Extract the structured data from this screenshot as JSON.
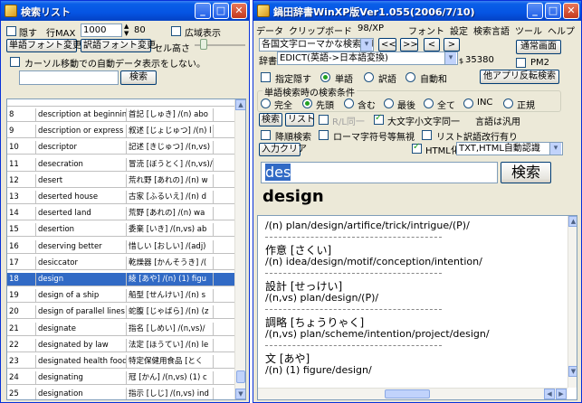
{
  "left": {
    "title": "検索リスト",
    "hide_label": "隠す",
    "row_max_label": "行MAX",
    "row_max_value": "1000",
    "spin_value": "80",
    "wide_display_label": "広域表示",
    "headword_font_btn": "単語フォント変更",
    "translation_font_btn": "訳語フォント変更",
    "cell_height_label": "セル高さ",
    "cursor_autodisplay_label": "カーソル移動での自動データ表示をしない。",
    "search_btn": "検索",
    "rows": [
      {
        "n": "8",
        "en": "description at beginnin",
        "ja": "首記 [しゅき] /(n) abo"
      },
      {
        "n": "9",
        "en": "description or express",
        "ja": "叙述 [じょじゅつ] /(n) l"
      },
      {
        "n": "10",
        "en": "descriptor",
        "ja": "記述 [きじゅつ] /(n,vs)"
      },
      {
        "n": "11",
        "en": "desecration",
        "ja": "冒涜 [ぼうとく] /(n,vs)/"
      },
      {
        "n": "12",
        "en": "desert",
        "ja": "荒れ野 [あれの] /(n) w"
      },
      {
        "n": "13",
        "en": "deserted house",
        "ja": "古家 [ふるいえ] /(n) d"
      },
      {
        "n": "14",
        "en": "deserted land",
        "ja": "荒野 [あれの] /(n) wa"
      },
      {
        "n": "15",
        "en": "desertion",
        "ja": "委棄 [いき] /(n,vs) ab"
      },
      {
        "n": "16",
        "en": "deserving better",
        "ja": "惜しい [おしい] /(adj)"
      },
      {
        "n": "17",
        "en": "desiccator",
        "ja": "乾燥器 [かんそうき] /("
      },
      {
        "n": "18",
        "en": "design",
        "ja": "綾 [あや] /(n) (1) figu"
      },
      {
        "n": "19",
        "en": "design of a ship",
        "ja": "船型 [せんけい] /(n) s"
      },
      {
        "n": "20",
        "en": "design of parallel lines",
        "ja": "蛇腹 [じゃばら] /(n) (z"
      },
      {
        "n": "21",
        "en": "designate",
        "ja": "指名 [しめい] /(n,vs)/"
      },
      {
        "n": "22",
        "en": "designated by law",
        "ja": "法定 [ほうてい] /(n) le"
      },
      {
        "n": "23",
        "en": "designated health food",
        "ja": "特定保健用食品 [とく"
      },
      {
        "n": "24",
        "en": "designating",
        "ja": "冠 [かん] /(n,vs) (1) c"
      },
      {
        "n": "25",
        "en": "designation",
        "ja": "指示 [しじ] /(n,vs) ind"
      }
    ],
    "selected_index": 10
  },
  "right": {
    "title": "鍋田辞書WinXP版Ver1.055(2006/7/10)",
    "menu": [
      "データ",
      "クリップボード",
      "98/XP",
      "フォント",
      "設定",
      "検索言語",
      "ツール",
      "ヘルプ"
    ],
    "romaji_select": "各国文字ローマかな検索無し",
    "nav_prev2": "<<",
    "nav_next2": ">>",
    "nav_prev": "<",
    "nav_next": ">",
    "normal_screen_btn": "通常画面",
    "dict_label": "辞書",
    "dict_select": "EDICT(英語->日本語変換)",
    "dict_count": "35380",
    "pm2_label": "PM2",
    "hide_designation_label": "指定隠す",
    "mode_word": "単語",
    "mode_translation": "訳語",
    "mode_auto": "自動和",
    "reverse_search_btn": "他アプリ反転検索",
    "group_label": "単語検索時の検索条件",
    "cond_complete": "完全",
    "cond_prefix": "先頭",
    "cond_contains": "含む",
    "cond_suffix": "最後",
    "cond_all": "全て",
    "cond_inc": "INC",
    "cond_regex": "正規",
    "search_btn": "検索",
    "list_btn": "リスト",
    "r_same_label": "R/L同一",
    "case_same_label": "大文字小文字同一",
    "translation_general": "言語は汎用",
    "descending_label": "降順検索",
    "roman_ignore_label": "ローマ字符号等無視",
    "list_translation_break": "リスト訳語改行有り",
    "input_clear_btn": "入力クリア",
    "html_label": "HTML化",
    "html_select": "TXT,HTML自動認識",
    "search_input": "des",
    "search_big_btn": "検索",
    "headword": "design",
    "result_lines": [
      {
        "kind": "def",
        "text": "/(n) plan/design/artifice/trick/intrigue/(P)/"
      },
      {
        "kind": "sep",
        "text": ""
      },
      {
        "kind": "head",
        "text": "作意 [さくい]"
      },
      {
        "kind": "def",
        "text": "/(n) idea/design/motif/conception/intention/"
      },
      {
        "kind": "sep",
        "text": ""
      },
      {
        "kind": "head",
        "text": "設計 [せっけい]"
      },
      {
        "kind": "def",
        "text": "/(n,vs) plan/design/(P)/"
      },
      {
        "kind": "sep",
        "text": ""
      },
      {
        "kind": "head",
        "text": "調略 [ちょうりゃく]"
      },
      {
        "kind": "def",
        "text": "/(n,vs) plan/scheme/intention/project/design/"
      },
      {
        "kind": "sep",
        "text": ""
      },
      {
        "kind": "head",
        "text": "文 [あや]"
      },
      {
        "kind": "def",
        "text": "/(n) (1) figure/design/"
      }
    ]
  }
}
